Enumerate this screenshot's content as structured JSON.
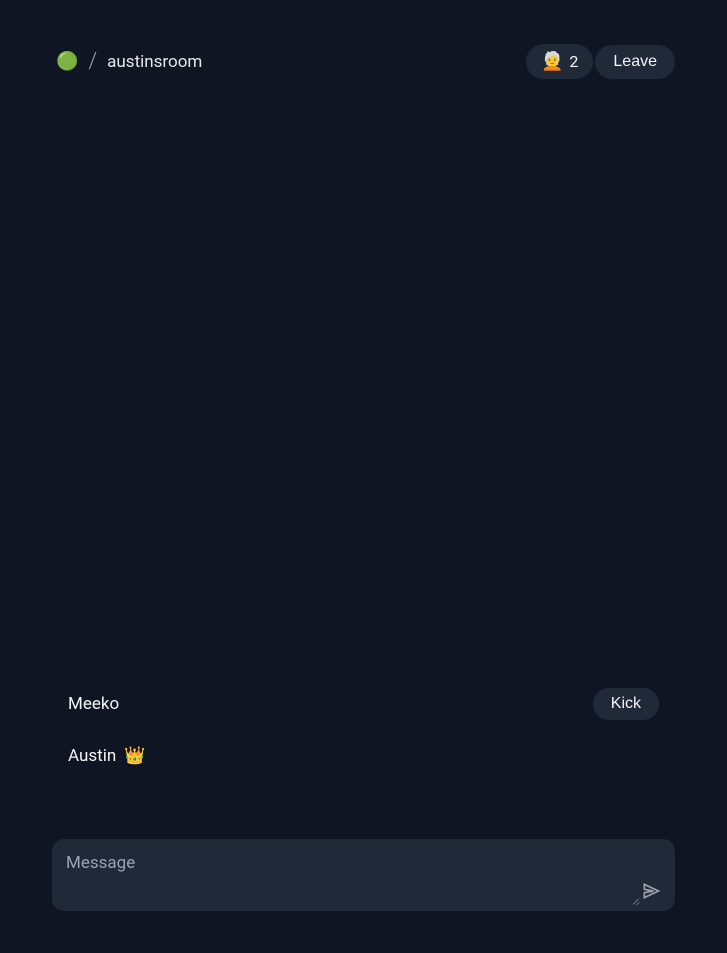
{
  "header": {
    "status_indicator": "🟢",
    "separator": "/",
    "room_name": "austinsroom",
    "user_count_emoji": "🧑‍🦳",
    "user_count": "2",
    "leave_label": "Leave"
  },
  "users": [
    {
      "name": "Meeko",
      "is_owner": false,
      "kick_label": "Kick"
    },
    {
      "name": "Austin",
      "is_owner": true,
      "crown": "👑"
    }
  ],
  "message": {
    "placeholder": "Message",
    "value": ""
  }
}
